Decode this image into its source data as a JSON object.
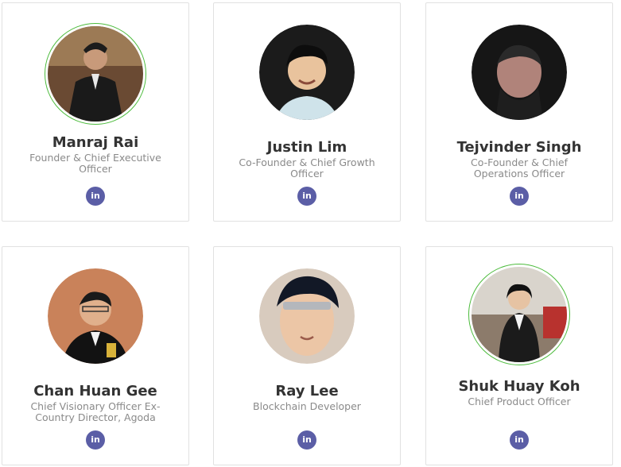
{
  "team": [
    {
      "name": "Manraj Rai",
      "role": "Founder & Chief Executive Officer",
      "social": "linkedin-icon",
      "social_label": "in"
    },
    {
      "name": "Justin Lim",
      "role": "Co-Founder & Chief Growth Officer",
      "social": "linkedin-icon",
      "social_label": "in"
    },
    {
      "name": "Tejvinder Singh",
      "role": "Co-Founder & Chief Operations Officer",
      "social": "linkedin-icon",
      "social_label": "in"
    },
    {
      "name": "Chan Huan Gee",
      "role": "Chief Visionary Officer Ex-Country Director, Agoda",
      "social": "linkedin-icon",
      "social_label": "in"
    },
    {
      "name": "Ray Lee",
      "role": "Blockchain Developer",
      "social": "linkedin-icon",
      "social_label": "in"
    },
    {
      "name": "Shuk Huay Koh",
      "role": "Chief Product Officer",
      "social": "linkedin-icon",
      "social_label": "in"
    }
  ],
  "colors": {
    "accent_ring": "#4cbb3c",
    "linkedin": "#5b5ea6",
    "name_text": "#333333",
    "role_text": "#8a8a8a"
  }
}
